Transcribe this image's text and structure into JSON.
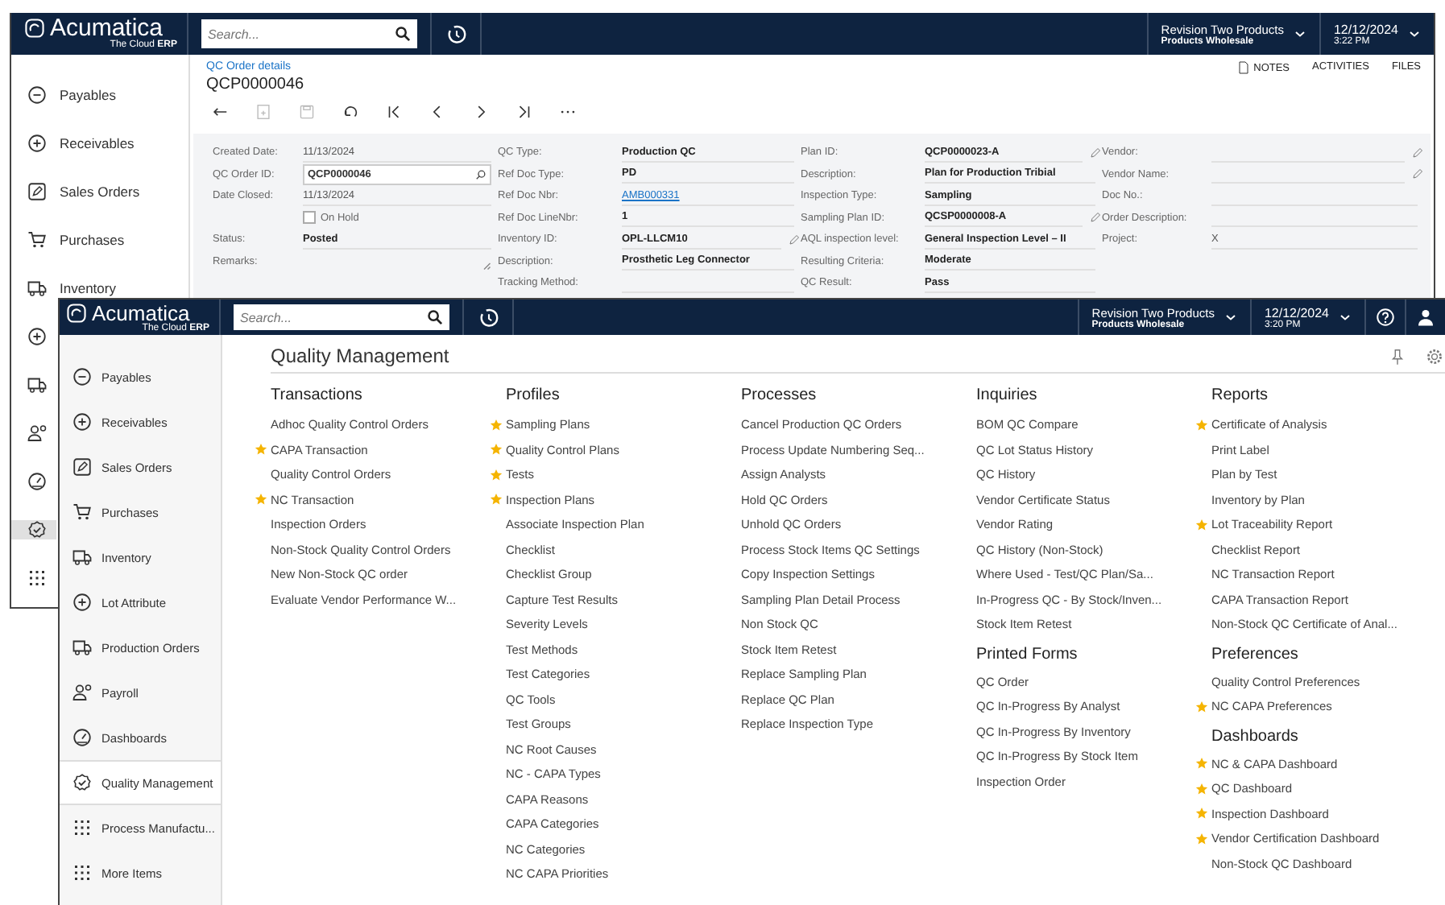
{
  "back_window": {
    "logo": {
      "name": "Acumatica",
      "tagline": "The Cloud **ERP**"
    },
    "header": {
      "search_placeholder": "Search...",
      "company": "Revision Two Products",
      "branch": "Products Wholesale",
      "date": "12/12/2024",
      "time": "3:22 PM"
    },
    "sidebar": [
      {
        "label": "Payables",
        "kind": "minus",
        "selected": false
      },
      {
        "label": "Receivables",
        "kind": "plus",
        "selected": false
      },
      {
        "label": "Sales Orders",
        "kind": "pencil",
        "selected": false
      },
      {
        "label": "Purchases",
        "kind": "cart",
        "selected": false
      },
      {
        "label": "Inventory",
        "kind": "truck",
        "selected": false
      },
      {
        "kind": "plus",
        "selected": false
      },
      {
        "kind": "truck",
        "selected": false
      },
      {
        "kind": "payroll",
        "selected": false
      },
      {
        "kind": "gauge",
        "selected": false
      },
      {
        "kind": "check",
        "selected": true
      },
      {
        "kind": "grid",
        "selected": false
      }
    ],
    "breadcrumb": "QC Order details",
    "title": "QCP0000046",
    "actions": [
      "NOTES",
      "ACTIVITIES",
      "FILES"
    ],
    "form_columns": [
      [
        {
          "label": "Created Date:",
          "value": "11/13/2024",
          "kind": "readonly"
        },
        {
          "label": "QC Order ID:",
          "value": "QCP0000046",
          "kind": "input"
        },
        {
          "label": "Date Closed:",
          "value": "11/13/2024",
          "kind": "readonly"
        },
        {
          "label": "On Hold",
          "checked": false,
          "kind": "checkbox"
        },
        {
          "label": "Status:",
          "value": "Posted",
          "kind": "text"
        },
        {
          "label": "Remarks:",
          "kind": "textarea"
        }
      ],
      [
        {
          "label": "QC Type:",
          "value": "Production QC",
          "kind": "text"
        },
        {
          "label": "Ref Doc Type:",
          "value": "PD",
          "kind": "text"
        },
        {
          "label": "Ref Doc Nbr:",
          "value": "AMB000331",
          "kind": "link"
        },
        {
          "label": "Ref Doc LineNbr:",
          "value": "1",
          "kind": "text"
        },
        {
          "label": "Inventory ID:",
          "value": "OPL-LLCM10",
          "kind": "lookup"
        },
        {
          "label": "Description:",
          "value": "Prosthetic Leg Connector",
          "kind": "text"
        },
        {
          "label": "Tracking Method:",
          "kind": "text"
        }
      ],
      [
        {
          "label": "Plan ID:",
          "value": "QCP0000023-A",
          "kind": "lookup"
        },
        {
          "label": "Description:",
          "value": "Plan for Production Tribial",
          "kind": "text"
        },
        {
          "label": "Inspection Type:",
          "value": "Sampling",
          "kind": "text"
        },
        {
          "label": "Sampling Plan ID:",
          "value": "QCSP0000008-A",
          "kind": "lookup"
        },
        {
          "label": "AQL inspection level:",
          "value": "General Inspection Level – II",
          "kind": "text"
        },
        {
          "label": "Resulting Criteria:",
          "value": "Moderate",
          "kind": "text"
        },
        {
          "label": "QC Result:",
          "value": "Pass",
          "kind": "text"
        }
      ],
      [
        {
          "label": "Vendor:",
          "kind": "lookup"
        },
        {
          "label": "Vendor Name:",
          "kind": "lookup"
        },
        {
          "label": "Doc No.:",
          "kind": "text"
        },
        {
          "label": "Order Description:",
          "kind": "text"
        },
        {
          "label": "Project:",
          "value": "X",
          "kind": "readonly"
        }
      ]
    ]
  },
  "front_window": {
    "logo": {
      "name": "Acumatica",
      "tagline": "The Cloud **ERP**"
    },
    "header": {
      "search_placeholder": "Search...",
      "company": "Revision Two Products",
      "branch": "Products Wholesale",
      "date": "12/12/2024",
      "time": "3:20 PM"
    },
    "sidebar": [
      {
        "label": "Payables",
        "kind": "minus",
        "selected": false
      },
      {
        "label": "Receivables",
        "kind": "plus",
        "selected": false
      },
      {
        "label": "Sales Orders",
        "kind": "pencil",
        "selected": false
      },
      {
        "label": "Purchases",
        "kind": "cart",
        "selected": false
      },
      {
        "label": "Inventory",
        "kind": "truck",
        "selected": false
      },
      {
        "label": "Lot Attribute",
        "kind": "plus",
        "selected": false
      },
      {
        "label": "Production Orders",
        "kind": "truck",
        "selected": false
      },
      {
        "label": "Payroll",
        "kind": "payroll",
        "selected": false
      },
      {
        "label": "Dashboards",
        "kind": "gauge",
        "selected": false
      },
      {
        "label": "Quality Management",
        "kind": "check",
        "selected": true
      },
      {
        "label": "Process Manufactu...",
        "kind": "grid",
        "selected": false
      },
      {
        "label": "More Items",
        "kind": "grid",
        "selected": false
      }
    ],
    "page_title": "Quality Management",
    "menu_columns": [
      {
        "sections": [
          {
            "heading": "Transactions",
            "items": [
              {
                "label": "Adhoc Quality Control Orders",
                "starred": false
              },
              {
                "label": "CAPA Transaction",
                "starred": true
              },
              {
                "label": "Quality Control Orders",
                "starred": false
              },
              {
                "label": "NC Transaction",
                "starred": true
              },
              {
                "label": "Inspection Orders",
                "starred": false
              },
              {
                "label": "Non-Stock Quality Control Orders",
                "starred": false
              },
              {
                "label": "New Non-Stock QC order",
                "starred": false
              },
              {
                "label": "Evaluate Vendor Performance W...",
                "starred": false
              }
            ]
          }
        ]
      },
      {
        "sections": [
          {
            "heading": "Profiles",
            "items": [
              {
                "label": "Sampling Plans",
                "starred": true
              },
              {
                "label": "Quality Control Plans",
                "starred": true
              },
              {
                "label": "Tests",
                "starred": true
              },
              {
                "label": "Inspection Plans",
                "starred": true
              },
              {
                "label": "Associate Inspection Plan",
                "starred": false
              },
              {
                "label": "Checklist",
                "starred": false
              },
              {
                "label": "Checklist Group",
                "starred": false
              },
              {
                "label": "Capture Test Results",
                "starred": false
              },
              {
                "label": "Severity Levels",
                "starred": false
              },
              {
                "label": "Test Methods",
                "starred": false
              },
              {
                "label": "Test Categories",
                "starred": false
              },
              {
                "label": "QC Tools",
                "starred": false
              },
              {
                "label": "Test Groups",
                "starred": false
              },
              {
                "label": "NC Root Causes",
                "starred": false
              },
              {
                "label": "NC - CAPA Types",
                "starred": false
              },
              {
                "label": "CAPA Reasons",
                "starred": false
              },
              {
                "label": "CAPA Categories",
                "starred": false
              },
              {
                "label": "NC Categories",
                "starred": false
              },
              {
                "label": "NC CAPA Priorities",
                "starred": false
              }
            ]
          }
        ]
      },
      {
        "sections": [
          {
            "heading": "Processes",
            "items": [
              {
                "label": "Cancel Production QC Orders",
                "starred": false
              },
              {
                "label": "Process Update Numbering Seq...",
                "starred": false
              },
              {
                "label": "Assign Analysts",
                "starred": false
              },
              {
                "label": "Hold QC Orders",
                "starred": false
              },
              {
                "label": "Unhold QC Orders",
                "starred": false
              },
              {
                "label": "Process Stock Items QC Settings",
                "starred": false
              },
              {
                "label": "Copy Inspection Settings",
                "starred": false
              },
              {
                "label": "Sampling Plan Detail Process",
                "starred": false
              },
              {
                "label": "Non Stock QC",
                "starred": false
              },
              {
                "label": "Stock Item Retest",
                "starred": false
              },
              {
                "label": "Replace Sampling Plan",
                "starred": false
              },
              {
                "label": "Replace QC Plan",
                "starred": false
              },
              {
                "label": "Replace Inspection Type",
                "starred": false
              }
            ]
          }
        ]
      },
      {
        "sections": [
          {
            "heading": "Inquiries",
            "items": [
              {
                "label": "BOM QC Compare",
                "starred": false
              },
              {
                "label": "QC Lot Status History",
                "starred": false
              },
              {
                "label": "QC History",
                "starred": false
              },
              {
                "label": "Vendor Certificate Status",
                "starred": false
              },
              {
                "label": "Vendor Rating",
                "starred": false
              },
              {
                "label": "QC History (Non-Stock)",
                "starred": false
              },
              {
                "label": "Where Used - Test/QC Plan/Sa...",
                "starred": false
              },
              {
                "label": "In-Progress QC - By Stock/Inven...",
                "starred": false
              },
              {
                "label": "Stock Item Retest",
                "starred": false
              }
            ]
          },
          {
            "heading": "Printed Forms",
            "items": [
              {
                "label": "QC Order",
                "starred": false
              },
              {
                "label": "QC In-Progress By Analyst",
                "starred": false
              },
              {
                "label": "QC In-Progress By Inventory",
                "starred": false
              },
              {
                "label": "QC In-Progress By Stock Item",
                "starred": false
              },
              {
                "label": "Inspection Order",
                "starred": false
              }
            ]
          }
        ]
      },
      {
        "sections": [
          {
            "heading": "Reports",
            "items": [
              {
                "label": "Certificate of Analysis",
                "starred": true
              },
              {
                "label": "Print Label",
                "starred": false
              },
              {
                "label": "Plan by Test",
                "starred": false
              },
              {
                "label": "Inventory by Plan",
                "starred": false
              },
              {
                "label": "Lot Traceability Report",
                "starred": true
              },
              {
                "label": "Checklist Report",
                "starred": false
              },
              {
                "label": "NC Transaction Report",
                "starred": false
              },
              {
                "label": "CAPA Transaction Report",
                "starred": false
              },
              {
                "label": "Non-Stock QC Certificate of Anal...",
                "starred": false
              }
            ]
          },
          {
            "heading": "Preferences",
            "items": [
              {
                "label": "Quality Control Preferences",
                "starred": false
              },
              {
                "label": "NC CAPA Preferences",
                "starred": true
              }
            ]
          },
          {
            "heading": "Dashboards",
            "items": [
              {
                "label": "NC & CAPA Dashboard",
                "starred": true
              },
              {
                "label": "QC Dashboard",
                "starred": true
              },
              {
                "label": "Inspection Dashboard",
                "starred": true
              },
              {
                "label": "Vendor Certification Dashboard",
                "starred": true
              },
              {
                "label": "Non-Stock QC Dashboard",
                "starred": false
              }
            ]
          }
        ]
      }
    ]
  }
}
